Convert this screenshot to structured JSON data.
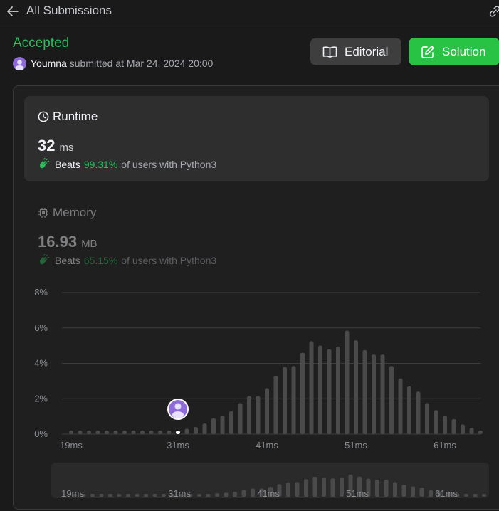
{
  "header": {
    "back_icon": "arrow-left-icon",
    "title": "All Submissions",
    "link_icon": "link-icon"
  },
  "submission": {
    "status": "Accepted",
    "status_color": "#2cbb5d",
    "user": "Youmna",
    "submitted_text": "submitted at Mar 24, 2024 20:00"
  },
  "actions": {
    "editorial_label": "Editorial",
    "solution_label": "Solution",
    "solution_color": "#28c244"
  },
  "runtime": {
    "title": "Runtime",
    "value": "32",
    "unit": "ms",
    "beats_label": "Beats",
    "beats_pct": "99.31%",
    "beats_suffix": "of users with Python3"
  },
  "memory": {
    "title": "Memory",
    "value": "16.93",
    "unit": "MB",
    "beats_label": "Beats",
    "beats_pct": "65.15%",
    "beats_suffix": "of users with Python3"
  },
  "chart_data": {
    "type": "bar",
    "y_tick_labels": [
      "0%",
      "2%",
      "4%",
      "6%",
      "8%"
    ],
    "ylim": [
      0,
      8
    ],
    "x_tick_labels": [
      "19ms",
      "31ms",
      "41ms",
      "51ms",
      "61ms"
    ],
    "x_tick_values": [
      19,
      31,
      41,
      51,
      61
    ],
    "x": [
      19,
      20,
      21,
      22,
      23,
      24,
      25,
      26,
      27,
      28,
      29,
      30,
      31,
      32,
      33,
      34,
      35,
      36,
      37,
      38,
      39,
      40,
      41,
      42,
      43,
      44,
      45,
      46,
      47,
      48,
      49,
      50,
      51,
      52,
      53,
      54,
      55,
      56,
      57,
      58,
      59,
      60,
      61,
      62,
      63,
      64,
      65
    ],
    "values": [
      0.2,
      0.2,
      0.2,
      0.2,
      0.2,
      0.2,
      0.2,
      0.2,
      0.2,
      0.2,
      0.2,
      0.2,
      0.2,
      0.3,
      0.4,
      0.6,
      0.9,
      1.05,
      1.3,
      1.75,
      2.15,
      2.15,
      2.6,
      3.3,
      3.8,
      3.85,
      4.6,
      5.25,
      5.0,
      4.8,
      4.95,
      5.85,
      5.3,
      4.75,
      4.5,
      4.5,
      3.85,
      3.15,
      2.7,
      2.4,
      1.75,
      1.35,
      1.05,
      0.85,
      0.55,
      0.35,
      0.2
    ],
    "highlight_x": 31,
    "bar_color": "#4a4a4a",
    "highlight_color": "#ffffff",
    "marker_color": "#8e6bd8",
    "grid": true,
    "legend": "none"
  }
}
